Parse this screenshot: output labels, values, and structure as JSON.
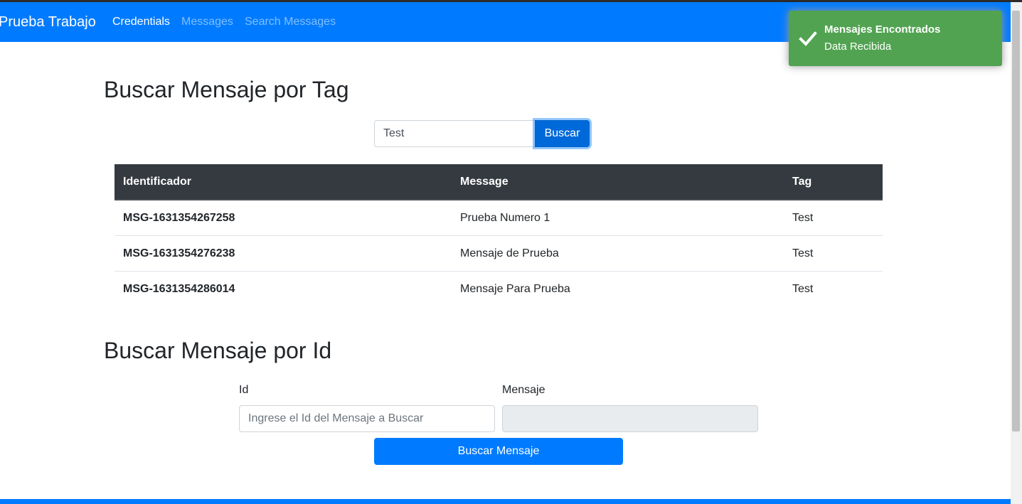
{
  "navbar": {
    "brand": "Prueba Trabajo",
    "links": [
      {
        "label": "Credentials",
        "active": true
      },
      {
        "label": "Messages",
        "active": false
      },
      {
        "label": "Search Messages",
        "active": false
      }
    ]
  },
  "toast": {
    "title": "Mensajes Encontrados",
    "message": "Data Recibida",
    "icon": "checkmark-icon",
    "color": "#51a351"
  },
  "tag_search": {
    "heading": "Buscar Mensaje por Tag",
    "input_value": "Test",
    "button_label": "Buscar"
  },
  "results_table": {
    "headers": [
      "Identificador",
      "Message",
      "Tag"
    ],
    "rows": [
      [
        "MSG-1631354267258",
        "Prueba Numero 1",
        "Test"
      ],
      [
        "MSG-1631354276238",
        "Mensaje de Prueba",
        "Test"
      ],
      [
        "MSG-1631354286014",
        "Mensaje Para Prueba",
        "Test"
      ]
    ]
  },
  "id_search": {
    "heading": "Buscar Mensaje por Id",
    "id_label": "Id",
    "id_placeholder": "Ingrese el Id del Mensaje a Buscar",
    "id_value": "",
    "mensaje_label": "Mensaje",
    "mensaje_value": "",
    "button_label": "Buscar Mensaje"
  },
  "colors": {
    "primary": "#007bff",
    "table_header": "#343a40",
    "toast_success": "#51a351"
  }
}
